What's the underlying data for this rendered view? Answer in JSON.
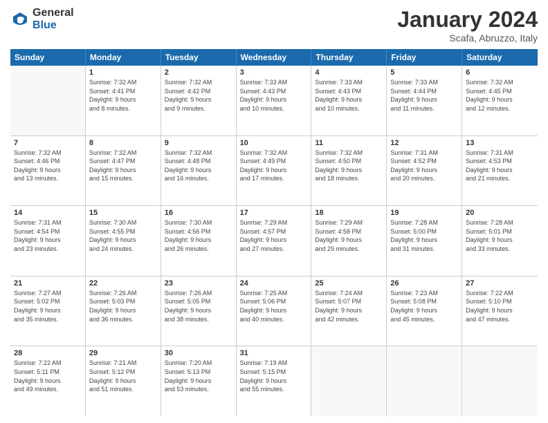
{
  "header": {
    "logo_general": "General",
    "logo_blue": "Blue",
    "title": "January 2024",
    "subtitle": "Scafa, Abruzzo, Italy"
  },
  "days_of_week": [
    "Sunday",
    "Monday",
    "Tuesday",
    "Wednesday",
    "Thursday",
    "Friday",
    "Saturday"
  ],
  "weeks": [
    [
      {
        "day": "",
        "info": ""
      },
      {
        "day": "1",
        "info": "Sunrise: 7:32 AM\nSunset: 4:41 PM\nDaylight: 9 hours\nand 8 minutes."
      },
      {
        "day": "2",
        "info": "Sunrise: 7:32 AM\nSunset: 4:42 PM\nDaylight: 9 hours\nand 9 minutes."
      },
      {
        "day": "3",
        "info": "Sunrise: 7:33 AM\nSunset: 4:43 PM\nDaylight: 9 hours\nand 10 minutes."
      },
      {
        "day": "4",
        "info": "Sunrise: 7:33 AM\nSunset: 4:43 PM\nDaylight: 9 hours\nand 10 minutes."
      },
      {
        "day": "5",
        "info": "Sunrise: 7:33 AM\nSunset: 4:44 PM\nDaylight: 9 hours\nand 11 minutes."
      },
      {
        "day": "6",
        "info": "Sunrise: 7:32 AM\nSunset: 4:45 PM\nDaylight: 9 hours\nand 12 minutes."
      }
    ],
    [
      {
        "day": "7",
        "info": "Sunrise: 7:32 AM\nSunset: 4:46 PM\nDaylight: 9 hours\nand 13 minutes."
      },
      {
        "day": "8",
        "info": "Sunrise: 7:32 AM\nSunset: 4:47 PM\nDaylight: 9 hours\nand 15 minutes."
      },
      {
        "day": "9",
        "info": "Sunrise: 7:32 AM\nSunset: 4:48 PM\nDaylight: 9 hours\nand 16 minutes."
      },
      {
        "day": "10",
        "info": "Sunrise: 7:32 AM\nSunset: 4:49 PM\nDaylight: 9 hours\nand 17 minutes."
      },
      {
        "day": "11",
        "info": "Sunrise: 7:32 AM\nSunset: 4:50 PM\nDaylight: 9 hours\nand 18 minutes."
      },
      {
        "day": "12",
        "info": "Sunrise: 7:31 AM\nSunset: 4:52 PM\nDaylight: 9 hours\nand 20 minutes."
      },
      {
        "day": "13",
        "info": "Sunrise: 7:31 AM\nSunset: 4:53 PM\nDaylight: 9 hours\nand 21 minutes."
      }
    ],
    [
      {
        "day": "14",
        "info": "Sunrise: 7:31 AM\nSunset: 4:54 PM\nDaylight: 9 hours\nand 23 minutes."
      },
      {
        "day": "15",
        "info": "Sunrise: 7:30 AM\nSunset: 4:55 PM\nDaylight: 9 hours\nand 24 minutes."
      },
      {
        "day": "16",
        "info": "Sunrise: 7:30 AM\nSunset: 4:56 PM\nDaylight: 9 hours\nand 26 minutes."
      },
      {
        "day": "17",
        "info": "Sunrise: 7:29 AM\nSunset: 4:57 PM\nDaylight: 9 hours\nand 27 minutes."
      },
      {
        "day": "18",
        "info": "Sunrise: 7:29 AM\nSunset: 4:58 PM\nDaylight: 9 hours\nand 29 minutes."
      },
      {
        "day": "19",
        "info": "Sunrise: 7:28 AM\nSunset: 5:00 PM\nDaylight: 9 hours\nand 31 minutes."
      },
      {
        "day": "20",
        "info": "Sunrise: 7:28 AM\nSunset: 5:01 PM\nDaylight: 9 hours\nand 33 minutes."
      }
    ],
    [
      {
        "day": "21",
        "info": "Sunrise: 7:27 AM\nSunset: 5:02 PM\nDaylight: 9 hours\nand 35 minutes."
      },
      {
        "day": "22",
        "info": "Sunrise: 7:26 AM\nSunset: 5:03 PM\nDaylight: 9 hours\nand 36 minutes."
      },
      {
        "day": "23",
        "info": "Sunrise: 7:26 AM\nSunset: 5:05 PM\nDaylight: 9 hours\nand 38 minutes."
      },
      {
        "day": "24",
        "info": "Sunrise: 7:25 AM\nSunset: 5:06 PM\nDaylight: 9 hours\nand 40 minutes."
      },
      {
        "day": "25",
        "info": "Sunrise: 7:24 AM\nSunset: 5:07 PM\nDaylight: 9 hours\nand 42 minutes."
      },
      {
        "day": "26",
        "info": "Sunrise: 7:23 AM\nSunset: 5:08 PM\nDaylight: 9 hours\nand 45 minutes."
      },
      {
        "day": "27",
        "info": "Sunrise: 7:22 AM\nSunset: 5:10 PM\nDaylight: 9 hours\nand 47 minutes."
      }
    ],
    [
      {
        "day": "28",
        "info": "Sunrise: 7:22 AM\nSunset: 5:11 PM\nDaylight: 9 hours\nand 49 minutes."
      },
      {
        "day": "29",
        "info": "Sunrise: 7:21 AM\nSunset: 5:12 PM\nDaylight: 9 hours\nand 51 minutes."
      },
      {
        "day": "30",
        "info": "Sunrise: 7:20 AM\nSunset: 5:13 PM\nDaylight: 9 hours\nand 53 minutes."
      },
      {
        "day": "31",
        "info": "Sunrise: 7:19 AM\nSunset: 5:15 PM\nDaylight: 9 hours\nand 55 minutes."
      },
      {
        "day": "",
        "info": ""
      },
      {
        "day": "",
        "info": ""
      },
      {
        "day": "",
        "info": ""
      }
    ]
  ]
}
